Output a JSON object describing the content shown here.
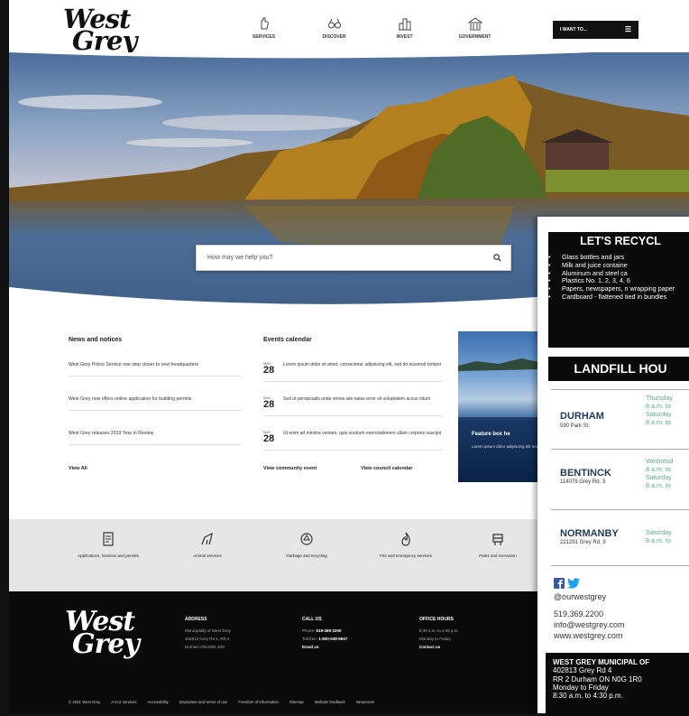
{
  "brand": {
    "logo_line1": "West",
    "logo_line2": "Grey"
  },
  "nav": [
    {
      "label": "SERVICES",
      "icon": "hand-icon"
    },
    {
      "label": "DISCOVER",
      "icon": "binoculars-icon"
    },
    {
      "label": "INVEST",
      "icon": "city-icon"
    },
    {
      "label": "GOVERNMENT",
      "icon": "town-hall-icon"
    }
  ],
  "header": {
    "iwant_label": "I WANT TO..."
  },
  "search": {
    "placeholder": "How may we help you?"
  },
  "news": {
    "heading": "News and notices",
    "items": [
      "West Grey Police Service one step closer to new headquarters",
      "West Grey now offers online application for building permits",
      "West Grey releases 2019 Year in Review"
    ],
    "view_all": "View All"
  },
  "events": {
    "heading": "Events calendar",
    "items": [
      {
        "month": "MAY",
        "day": "28",
        "text": "Lorem ipsum dolor sit amet, consectetur adipiscing elit, sed do eiusmod tempor"
      },
      {
        "month": "MAY",
        "day": "28",
        "text": "Sed ut perspiciatis unde omnis iste natus error sit voluptatem accus nitum"
      },
      {
        "month": "MAY",
        "day": "28",
        "text": "Ut enim ad minima veniam, quis nostrum exercitationem ullam corporis suscipit"
      }
    ],
    "view_community": "View community event",
    "view_council": "View council calendar"
  },
  "feature": {
    "title": "Feature box he",
    "text": "Lorem ipsum dolor adipiscing elit nec"
  },
  "quicklinks": [
    {
      "label": "Applications, licences and permits",
      "icon": "document-icon"
    },
    {
      "label": "Animal services",
      "icon": "animal-icon"
    },
    {
      "label": "Garbage and recycling",
      "icon": "recycle-icon"
    },
    {
      "label": "Fire and emergency services",
      "icon": "fire-icon"
    },
    {
      "label": "Parks and recreation",
      "icon": "parks-icon"
    }
  ],
  "footer": {
    "address": {
      "heading": "ADDRESS",
      "l1": "Municipality of West Grey",
      "l2": "402813 Grey Rd 4, RR 2",
      "l3": "Durham ON N0G 1R0"
    },
    "call": {
      "heading": "CALL US",
      "phone_label": "Phone: ",
      "phone": "519-369-2200",
      "toll_label": "Toll free: ",
      "toll": "1-800-538-9647",
      "email": "Email us"
    },
    "hours": {
      "heading": "OFFICE HOURS",
      "l1": "8:30 a.m. to 4:30 p.m.",
      "l2": "Monday to Friday",
      "contact": "Contact us"
    },
    "bar": [
      "© 2021 West Grey",
      "A to Z services",
      "Accessibility",
      "Disclaimer and terms of use",
      "Freedom of Information",
      "Sitemap",
      "Website feedback",
      "Newsroom"
    ]
  },
  "flyer": {
    "recycle_title": "LET'S RECYCL",
    "recycle_items": [
      "Glass bottles and jars",
      "Milk and juice containe",
      "Aluminum and steel ca",
      "Plastics No. 1, 2, 3, 4, 6",
      "Papers, newspapers, n wrapping paper",
      "Cardboard - flattened tied in bundles"
    ],
    "landfill_title": "LANDFILL HOU",
    "sites": [
      {
        "name": "DURHAM",
        "addr": "590 Park St.",
        "hours": [
          "Thursday",
          "8 a.m. to",
          "Saturday",
          "8 a.m. to"
        ]
      },
      {
        "name": "BENTINCK",
        "addr": "114079 Grey Rd. 3",
        "hours": [
          "Wednesd",
          "8 a.m. to",
          "Saturday",
          "8 a.m. to"
        ]
      },
      {
        "name": "NORMANBY",
        "addr": "221291 Grey Rd. 9",
        "hours": [
          "Saturday",
          "8 a.m. to"
        ]
      }
    ],
    "social_handle": "@ourwestgrey",
    "phone": "519.369.2200",
    "email": "info@westgrey.com",
    "web": "www.westgrey.com",
    "office_title": "WEST GREY MUNICIPAL OF",
    "office_lines": [
      "402813 Grey Rd 4",
      "RR 2 Durham ON N0G 1R0",
      "Monday to Friday",
      "8:30 a.m. to 4:30 p.m."
    ]
  }
}
